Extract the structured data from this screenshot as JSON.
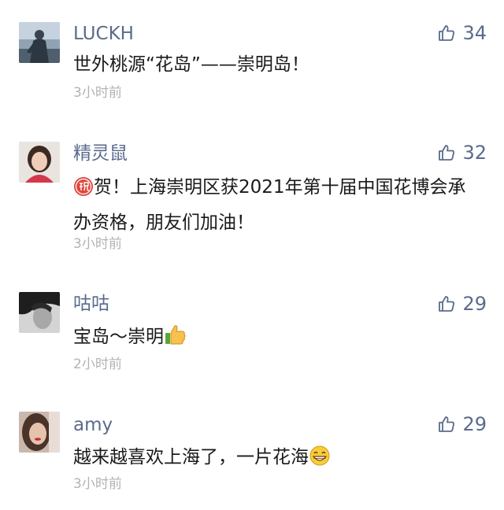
{
  "comments": [
    {
      "username": "LUCKH",
      "likes": "34",
      "text": "世外桃源“花岛”——崇明岛！",
      "time": "3小时前",
      "avatar": "man-in-coat-avatar"
    },
    {
      "username": "精灵鼠",
      "likes": "32",
      "prefix_emoji": "congratulations-emoji",
      "text": "贺！上海崇明区获2021年第十届中国花博会承办资格，朋友们加油！",
      "time": "3小时前",
      "avatar": "woman-portrait-avatar"
    },
    {
      "username": "咕咕",
      "likes": "29",
      "text": "宝岛～崇明",
      "suffix_emoji": "thumbs-up-emoji",
      "time": "2小时前",
      "avatar": "grayscale-person-avatar"
    },
    {
      "username": "amy",
      "likes": "29",
      "text": "越来越喜欢上海了，一片花海",
      "suffix_emoji": "grin-emoji",
      "time": "3小时前",
      "avatar": "woman-red-lips-avatar"
    }
  ],
  "colors": {
    "username": "#5a6b8c",
    "text": "#1a1a1a",
    "time": "#b3b3b3",
    "like": "#5a6b8c"
  }
}
